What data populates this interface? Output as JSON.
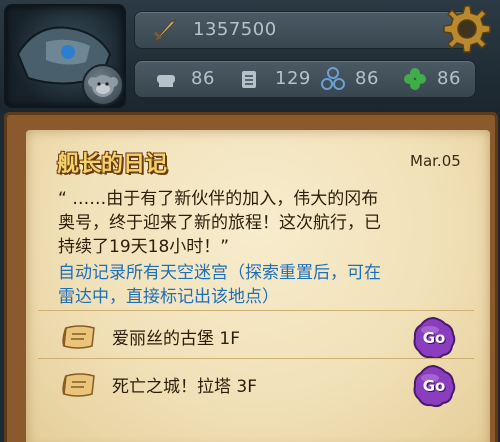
{
  "hud": {
    "gold_value": "1357500",
    "stats": [
      {
        "icon": "cannon-icon",
        "value": "86"
      },
      {
        "icon": "book-icon",
        "value": "129"
      },
      {
        "icon": "propeller-icon",
        "value": "86"
      },
      {
        "icon": "clover-icon",
        "value": "86"
      }
    ]
  },
  "diary": {
    "title": "舰长的日记",
    "date": "Mar.05",
    "lines": [
      "“ ……由于有了新伙伴的加入，伟大的冈布",
      "奥号，终于迎来了新的旅程！这次航行，已",
      "持续了19天18小时！”"
    ],
    "hint_lines": [
      "自动记录所有天空迷宫（探索重置后，可在",
      "雷达中，直接标记出该地点）"
    ]
  },
  "locations": [
    {
      "label": "爱丽丝的古堡 1F",
      "button": "Go"
    },
    {
      "label": "死亡之城！拉塔 3F",
      "button": "Go"
    }
  ],
  "colors": {
    "title_fill": "#f3d36a",
    "hint_text": "#1f6fb8",
    "go_button": "#8a3dbf"
  }
}
